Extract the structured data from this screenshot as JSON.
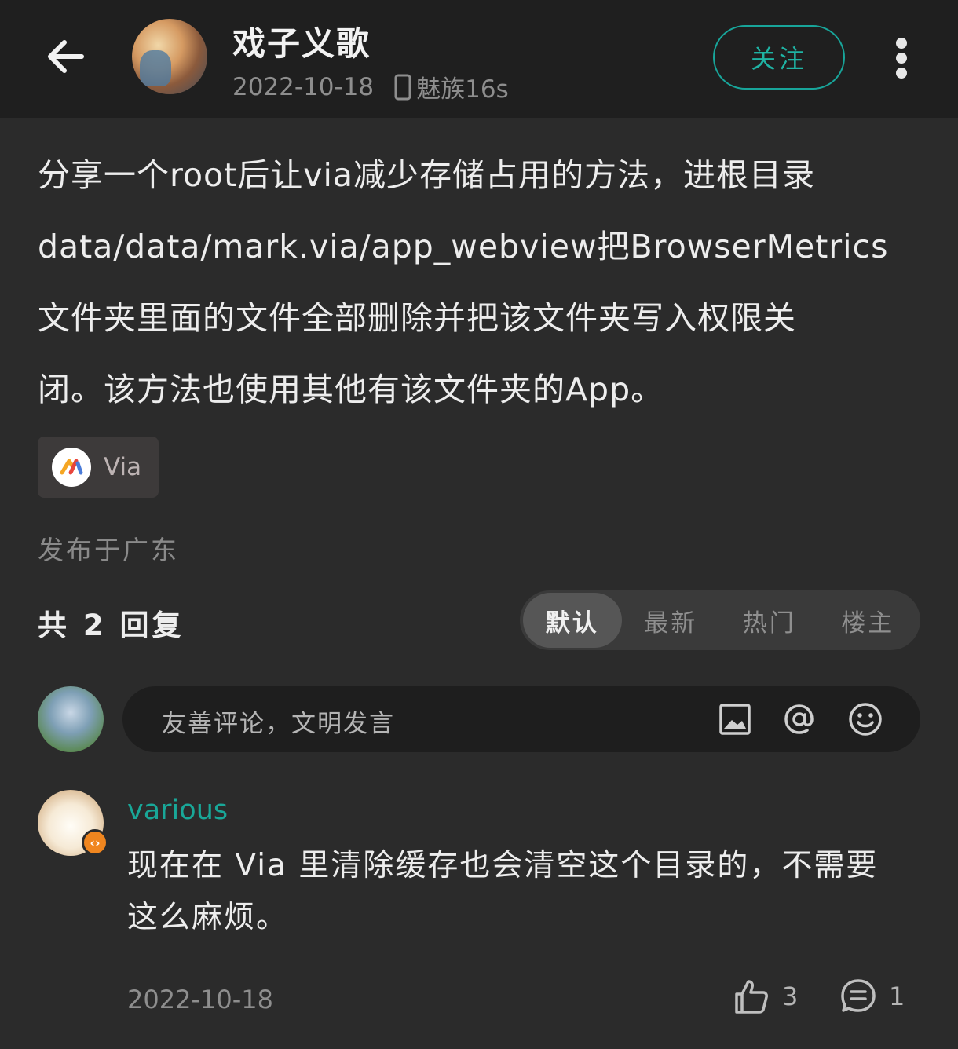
{
  "header": {
    "username": "戏子义歌",
    "date": "2022-10-18",
    "device": "魅族16s",
    "follow_label": "关注"
  },
  "post": {
    "line1": "分享一个root后让via减少存储占用的方法，进根目录",
    "line2": "data/data/mark.via/app_webview把BrowserMetrics",
    "line3": "文件夹里面的文件全部删除并把该文件夹写入权限关",
    "line4": "闭。该方法也使用其他有该文件夹的App。",
    "tag_label": "Via",
    "location": "发布于广东"
  },
  "replies": {
    "count_label": "共 2 回复",
    "sort_tabs": [
      "默认",
      "最新",
      "热门",
      "楼主"
    ],
    "active_tab": "默认"
  },
  "comment_input": {
    "placeholder": "友善评论，文明发言"
  },
  "comment": {
    "username": "various",
    "text": "现在在 Via 里清除缓存也会清空这个目录的，不需要这么麻烦。",
    "date": "2022-10-18",
    "likes": "3",
    "replies": "1"
  },
  "colors": {
    "accent": "#19a798",
    "background": "#2b2b2b",
    "header_bg": "#1f1f1f",
    "badge": "#f0861f"
  },
  "icons": {
    "back": "arrow-left-icon",
    "more": "more-vertical-icon",
    "device": "phone-icon",
    "image": "image-icon",
    "mention": "at-icon",
    "emoji": "emoji-icon",
    "like": "thumbs-up-icon",
    "reply": "comment-icon"
  }
}
